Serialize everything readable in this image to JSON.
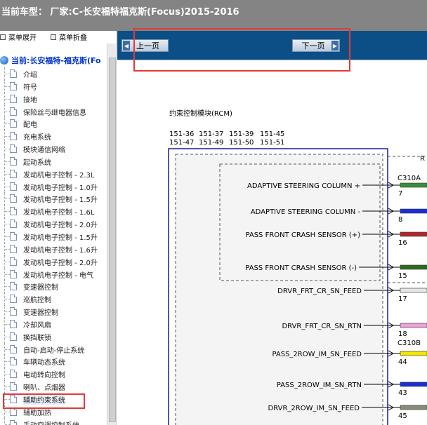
{
  "title": "当前车型：  厂家:C-长安福特福克斯(Focus)2015-2016",
  "sidebar": {
    "expand_label": "菜单展开",
    "collapse_label": "菜单折叠",
    "root_label": "当前:长安福特-福克斯(Fo",
    "items": [
      "介绍",
      "符号",
      "接地",
      "保险丝与继电器信息",
      "配电",
      "充电系统",
      "模块通信网络",
      "起动系统",
      "发动机电子控制 - 2.3L",
      "发动机电子控制 - 1.0升",
      "发动机电子控制 - 1.5升",
      "发动机电子控制 - 1.6L",
      "发动机电子控制 - 2.0升",
      "发动机电子控制 - 1.5升",
      "发动机电子控制 - 1.6升",
      "发动机电子控制 - 2.0升",
      "发动机电子控制 - 电气",
      "变速器控制",
      "巡航控制",
      "变速器控制",
      "冷却风扇",
      "换挡联锁",
      "自动-启动-停止系统",
      "车辆动态系统",
      "电动转向控制",
      "喇叭、点烟器",
      "辅助约束系统",
      "辅助加热",
      "手动空调控制系统"
    ],
    "active_index": 26
  },
  "nav": {
    "prev_label": "上一页",
    "next_label": "下一页"
  },
  "diagram": {
    "module_title": "约束控制模块(RCM)",
    "pins_top": [
      "151-36",
      "151-37",
      "151-39",
      "151-45"
    ],
    "pins_bottom": [
      "151-47",
      "151-49",
      "151-50",
      "151-51"
    ],
    "right_label": "R",
    "connector_a": "C310A",
    "connector_b": "C310B",
    "signals": [
      {
        "label": "ADAPTIVE STEERING COLUMN +",
        "pin": "7",
        "color": "#3a8f3a"
      },
      {
        "label": "ADAPTIVE STEERING COLUMN -",
        "pin": "8",
        "color": "#1a2fd6"
      },
      {
        "label": "PASS FRONT CRASH SENSOR (+)",
        "pin": "16",
        "color": "#b3262e"
      },
      {
        "label": "PASS FRONT CRASH SENSOR (-)",
        "pin": "15",
        "color": "#2e6b1e"
      },
      {
        "label": "DRVR_FRT_CR_SN_FEED",
        "pin": "17",
        "color": "#e6e6e6"
      },
      {
        "label": "DRVR_FRT_CR_SN_RTN",
        "pin": "18",
        "color": "#f0a0d8"
      },
      {
        "label": "PASS_2ROW_IM_SN_FEED",
        "pin": "44",
        "color": "#f2e600"
      },
      {
        "label": "PASS_2ROW_IM_SN_RTN",
        "pin": "43",
        "color": "#1a2fd6"
      },
      {
        "label": "DRVR_2ROW_IM_SN_FEED",
        "pin": "45",
        "color": "#8a8a7a"
      }
    ]
  }
}
